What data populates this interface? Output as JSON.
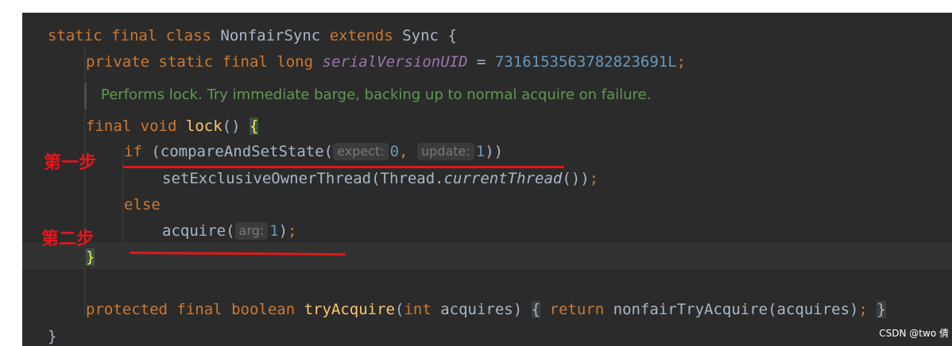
{
  "code": {
    "line1": {
      "kw1": "static",
      "kw2": "final",
      "kw3": "class",
      "name": "NonfairSync",
      "kw4": "extends",
      "parent": "Sync",
      "brace": "{"
    },
    "line2": {
      "kw1": "private",
      "kw2": "static",
      "kw3": "final",
      "kw4": "long",
      "field": "serialVersionUID",
      "op": "=",
      "value": "7316153563782823691L",
      "semi": ";"
    },
    "doc": "Performs lock. Try immediate barge, backing up to normal acquire on failure.",
    "line4": {
      "kw1": "final",
      "kw2": "void",
      "fn": "lock",
      "parens": "()",
      "brace": "{"
    },
    "line5": {
      "kw": "if",
      "call": "(compareAndSetState(",
      "hint1": "expect:",
      "arg1": "0",
      "comma": ",",
      "hint2": "update:",
      "arg2": "1",
      "close": "))"
    },
    "line6": {
      "call": "setExclusiveOwnerThread(Thread.",
      "method": "currentThread",
      "close": "())",
      "semi": ";"
    },
    "line7": {
      "kw": "else"
    },
    "line8": {
      "call": "acquire(",
      "hint": "arg:",
      "arg": "1",
      "close": ")",
      "semi": ";"
    },
    "line9": {
      "brace": "}"
    },
    "line11": {
      "kw1": "protected",
      "kw2": "final",
      "kw3": "boolean",
      "fn": "tryAcquire",
      "open": "(",
      "kw4": "int",
      "param": "acquires)",
      "brace_open": "{",
      "kw5": "return",
      "body": "nonfairTryAcquire(acquires)",
      "semi": ";",
      "brace_close": "}"
    },
    "line12": {
      "brace": "}"
    }
  },
  "annotations": {
    "step1": "第一步",
    "step2": "第二步"
  },
  "watermark": "CSDN @two 倩",
  "colors": {
    "background": "#2b2b2b",
    "keyword": "#cc7832",
    "function": "#ffc66d",
    "number": "#6897bb",
    "field": "#9876aa",
    "doc": "#629755",
    "annotation_red": "#e8161a"
  }
}
